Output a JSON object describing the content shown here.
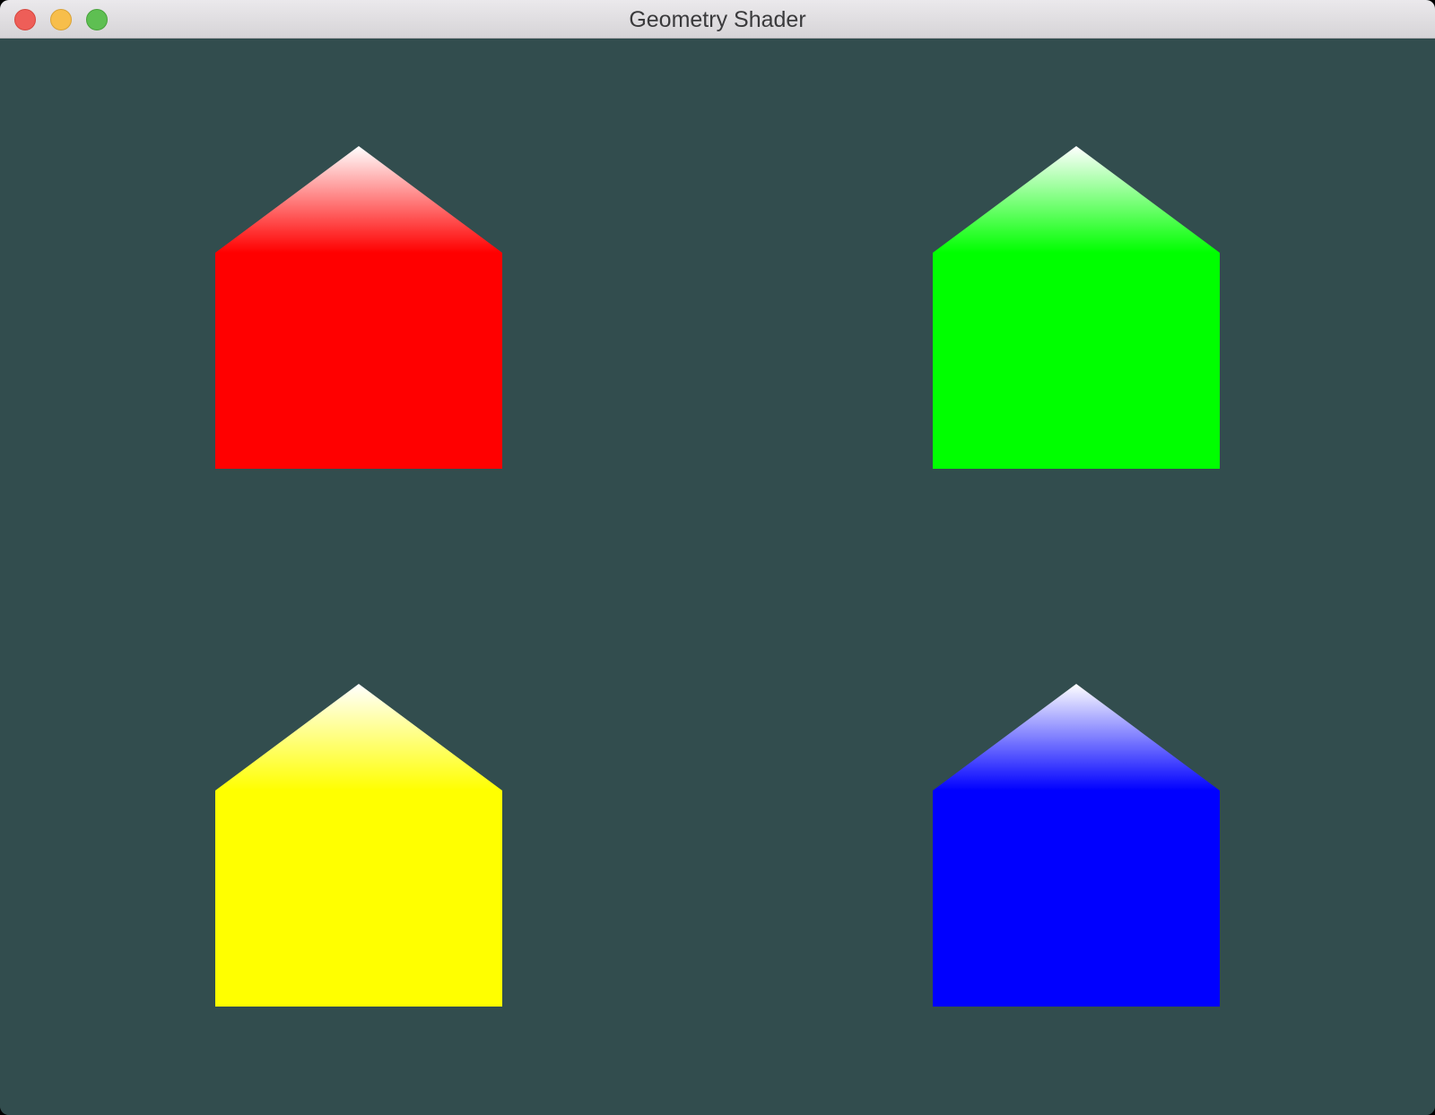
{
  "window": {
    "title": "Geometry Shader",
    "background_color": "#324d4e",
    "controls": [
      {
        "name": "close",
        "color": "#ee5e58",
        "border": "#d6473f"
      },
      {
        "name": "minimize",
        "color": "#f7be4b",
        "border": "#d9a236"
      },
      {
        "name": "zoom",
        "color": "#5ebf52",
        "border": "#48a23c"
      }
    ]
  },
  "houses": [
    {
      "name": "red-house",
      "color": "#ff0000",
      "roof_tip_color": "#ffffff"
    },
    {
      "name": "green-house",
      "color": "#00ff00",
      "roof_tip_color": "#ffffff"
    },
    {
      "name": "yellow-house",
      "color": "#ffff00",
      "roof_tip_color": "#ffffff"
    },
    {
      "name": "blue-house",
      "color": "#0000ff",
      "roof_tip_color": "#ffffff"
    }
  ]
}
